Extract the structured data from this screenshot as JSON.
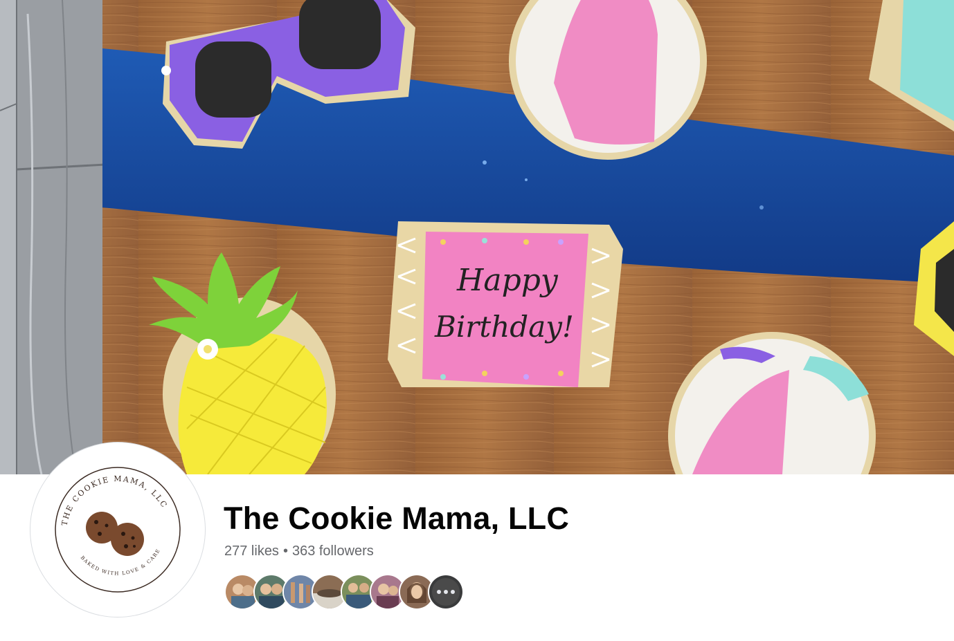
{
  "page": {
    "name": "The Cookie Mama, LLC",
    "likes": "277 likes",
    "separator": "•",
    "followers": "363 followers"
  },
  "cover": {
    "cookie_text_line1": "Happy",
    "cookie_text_line2": "Birthday!"
  },
  "profile": {
    "logo_top_text": "THE COOKIE MAMA, LLC",
    "logo_bottom_text": "BAKED WITH LOVE & CARE"
  },
  "follower_avatars": [
    {
      "icon": "avatar-1",
      "color": "#b98a65"
    },
    {
      "icon": "avatar-2",
      "color": "#5d7a6a"
    },
    {
      "icon": "avatar-3",
      "color": "#6f86a8"
    },
    {
      "icon": "avatar-4",
      "color": "#8b6d54"
    },
    {
      "icon": "avatar-5",
      "color": "#7b8f5c"
    },
    {
      "icon": "avatar-6",
      "color": "#a8788d"
    },
    {
      "icon": "avatar-7",
      "color": "#8a6a55"
    },
    {
      "icon": "more-followers-icon",
      "color": "#3a3b3c"
    }
  ],
  "colors": {
    "name": "#050505",
    "secondary_text": "#65676b",
    "wood": "#a86f3f",
    "resin": "#1e4fa6"
  }
}
